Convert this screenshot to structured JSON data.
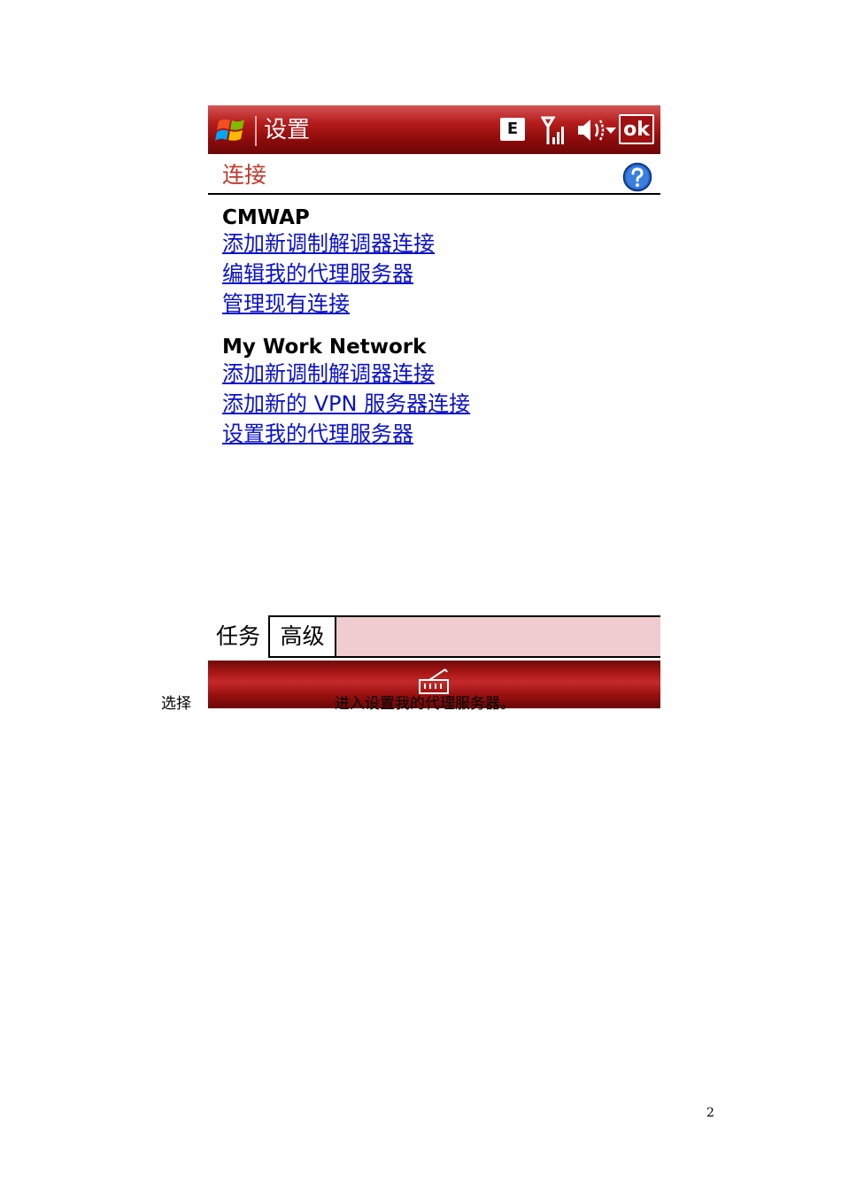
{
  "titlebar": {
    "title": "设置",
    "edge_label": "E",
    "ok_label": "ok",
    "icons": [
      "windows-start-flag-icon",
      "signal-strength-icon",
      "speaker-volume-icon"
    ]
  },
  "heading": {
    "label": "连接",
    "help_icon": "question-help-icon"
  },
  "sections": [
    {
      "title": "CMWAP",
      "links": [
        "添加新调制解调器连接",
        "编辑我的代理服务器",
        "管理现有连接"
      ]
    },
    {
      "title": "My Work Network",
      "links": [
        "添加新调制解调器连接",
        "添加新的 VPN 服务器连接",
        "设置我的代理服务器"
      ]
    }
  ],
  "tabs": [
    "任务",
    "高级"
  ],
  "softkey": {
    "icon": "input-panel-keyboard-icon"
  },
  "document": {
    "caption_left": "选择",
    "caption_right": "进入设置我的代理服务器。",
    "page_number": "2"
  },
  "colors": {
    "titlebar": "#a01010",
    "heading_text": "#c0392b",
    "link": "#0a12c8",
    "tabbar_fill": "#f0cbd0"
  }
}
